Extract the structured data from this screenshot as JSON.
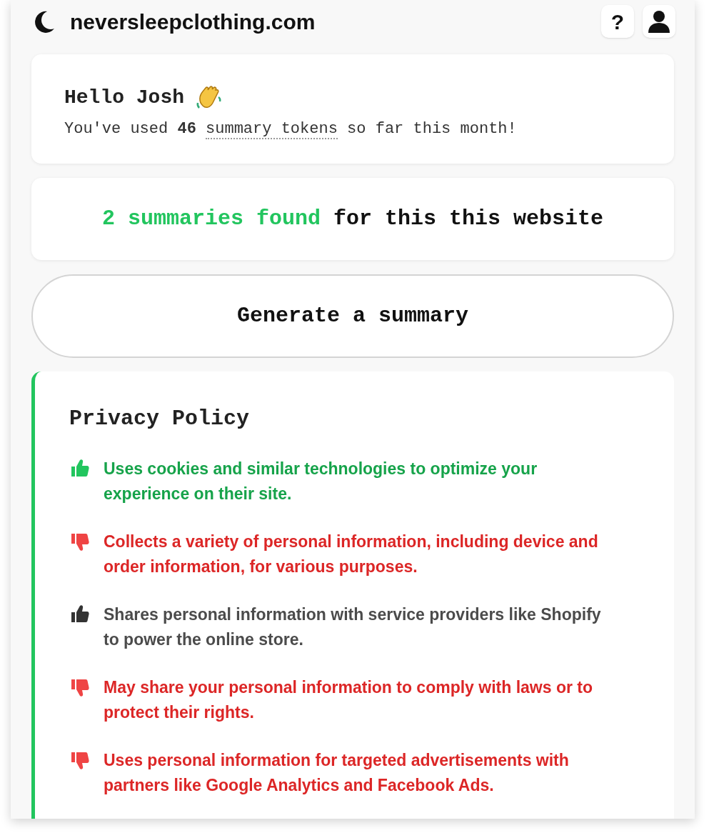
{
  "header": {
    "domain": "neversleepclothing.com",
    "help_label": "?"
  },
  "greeting": {
    "title": "Hello Josh",
    "usage_before": "You've used **46** ",
    "usage_link": "summary tokens",
    "usage_after": " so far this month!"
  },
  "summaries": {
    "count_text": "2 summaries found",
    "rest_text": " for this this website"
  },
  "generate_button": "Generate a summary",
  "policy": {
    "title": "Privacy Policy",
    "items": [
      {
        "kind": "good",
        "text": "Uses cookies and similar technologies to optimize your experience on their site."
      },
      {
        "kind": "bad",
        "text": "Collects a variety of personal information, including device and order information, for various purposes."
      },
      {
        "kind": "neutral",
        "text": "Shares personal information with service providers like Shopify to power the online store."
      },
      {
        "kind": "bad",
        "text": "May share your personal information to comply with laws or to protect their rights."
      },
      {
        "kind": "bad",
        "text": "Uses personal information for targeted advertisements with partners like Google Analytics and Facebook Ads."
      }
    ]
  }
}
